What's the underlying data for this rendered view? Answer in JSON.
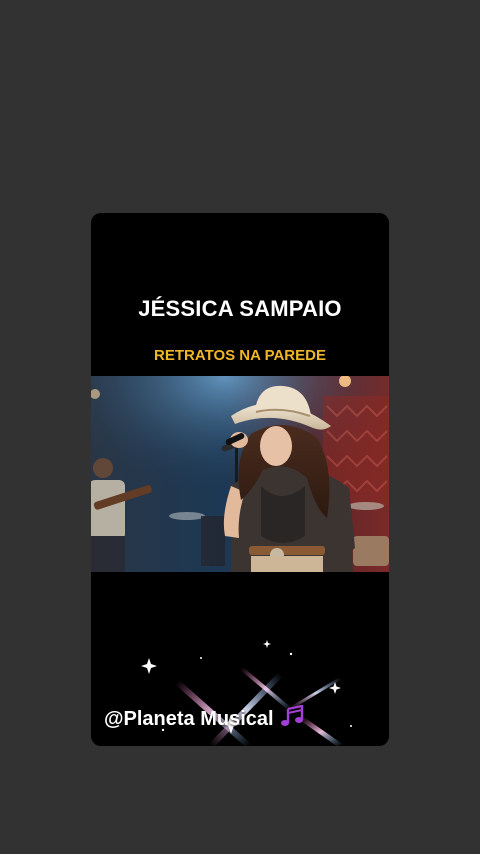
{
  "post": {
    "artist": "JÉSSICA SAMPAIO",
    "song": "RETRATOS NA PAREDE",
    "handle": "@Planeta Musical",
    "handle_icon": "music-notes-icon"
  },
  "colors": {
    "background": "#323232",
    "card": "#000000",
    "song_title": "#f0b626",
    "artist_title": "#ffffff",
    "notes": "#a23fd4"
  }
}
